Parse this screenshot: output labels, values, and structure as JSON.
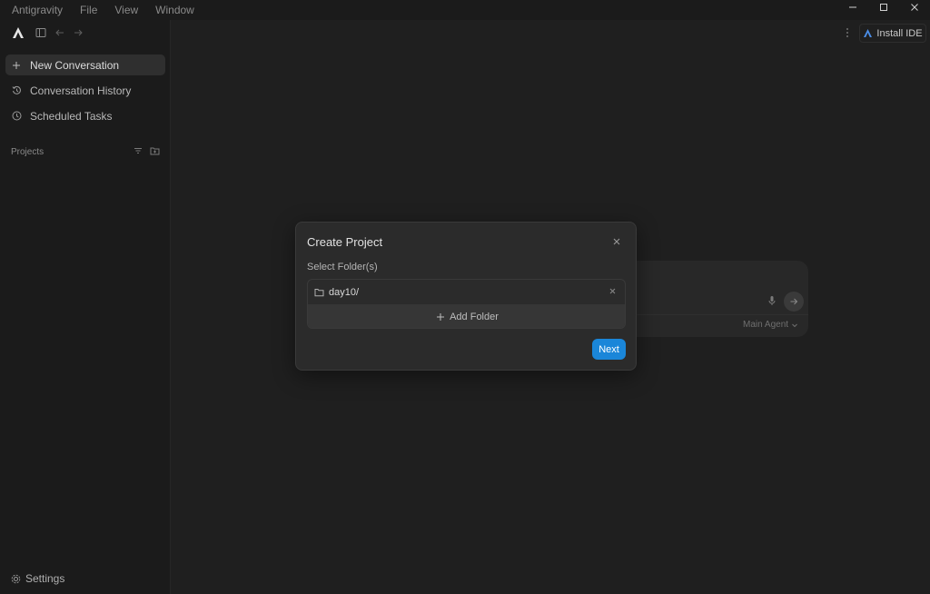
{
  "menu": [
    "Antigravity",
    "File",
    "View",
    "Window"
  ],
  "sidebar": {
    "items": [
      {
        "label": "New Conversation",
        "icon": "plus-icon"
      },
      {
        "label": "Conversation History",
        "icon": "history-icon"
      },
      {
        "label": "Scheduled Tasks",
        "icon": "clock-icon"
      }
    ],
    "projects_label": "Projects",
    "settings_label": "Settings"
  },
  "header": {
    "install_label": "Install IDE"
  },
  "composer": {
    "agent_label": "Main Agent"
  },
  "dialog": {
    "title": "Create Project",
    "subtitle": "Select Folder(s)",
    "folder_name": "day10/",
    "add_folder_label": "Add Folder",
    "next_label": "Next"
  },
  "colors": {
    "accent": "#1a86d9",
    "background": "#1f1f1f",
    "sidebar": "#1b1b1b"
  }
}
